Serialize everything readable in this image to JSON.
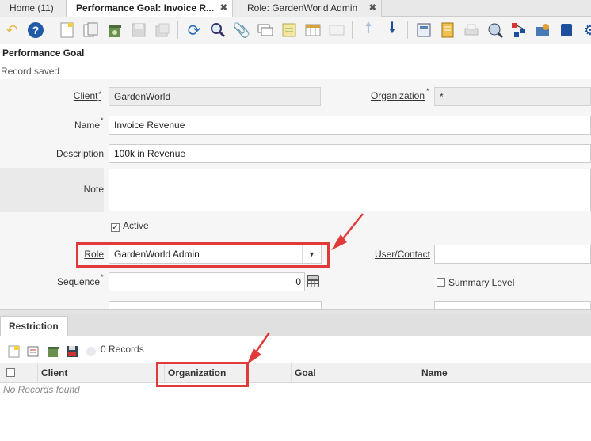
{
  "tabs": [
    {
      "label": "Home (11)"
    },
    {
      "label": "Performance Goal: Invoice R...",
      "close": "✖"
    },
    {
      "label": "Role: GardenWorld Admin",
      "close": "✖"
    }
  ],
  "window": {
    "title": "Performance Goal",
    "status": "Record saved"
  },
  "form": {
    "client_label": "Client",
    "client_value": "GardenWorld",
    "organization_label": "Organization",
    "organization_value": "*",
    "name_label": "Name",
    "name_value": "Invoice Revenue",
    "description_label": "Description",
    "description_value": "100k in Revenue",
    "note_label": "Note",
    "note_value": "",
    "active_label": "Active",
    "active_checked": true,
    "role_label": "Role",
    "role_value": "GardenWorld Admin",
    "user_label": "User/Contact",
    "user_value": "",
    "sequence_label": "Sequence",
    "sequence_value": "0",
    "summary_label": "Summary Level",
    "required_mark": "*"
  },
  "restriction": {
    "tab_label": "Restriction",
    "record_count": "0 Records",
    "columns": [
      "Client",
      "Organization",
      "Goal",
      "Name"
    ],
    "empty_text": "No Records found"
  },
  "colors": {
    "highlight": "#e03a3a",
    "toolbar_blue": "#2a6ebd"
  },
  "icons": [
    "undo-icon",
    "help-icon",
    "new-record-icon",
    "copy-icon",
    "delete-icon",
    "save-icon",
    "refresh-icon",
    "find-icon",
    "attachment-icon",
    "chat-icon",
    "archive-icon",
    "grid-toggle-icon",
    "up-icon",
    "down-icon",
    "report-icon",
    "print-icon",
    "zoom-across-icon",
    "workflow-icon",
    "process-icon",
    "exit-icon"
  ]
}
